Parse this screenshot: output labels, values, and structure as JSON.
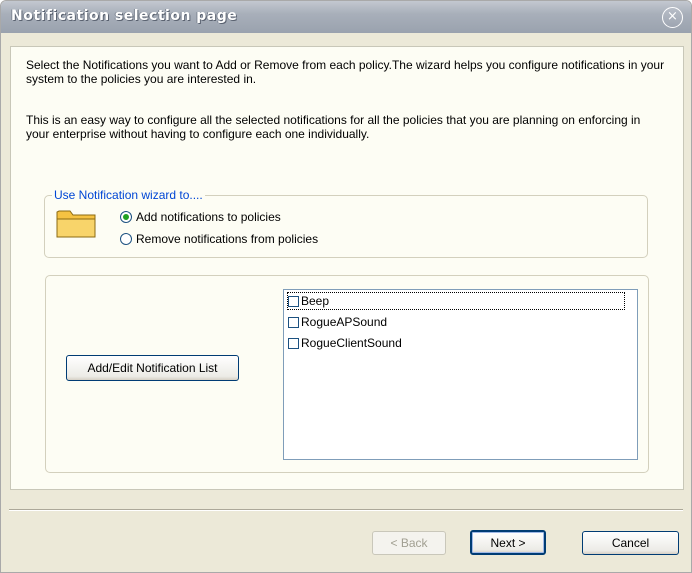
{
  "window": {
    "title": "Notification selection page",
    "close_glyph": "×"
  },
  "intro": {
    "paragraph1": "Select the Notifications you want to Add or Remove from each policy.The wizard helps you configure notifications in your system to the policies you are interested in.",
    "paragraph2": "This is an easy way to configure all the selected  notifications for all the policies that  you are planning on enforcing in your enterprise without having to configure each one individually."
  },
  "wizard_group": {
    "legend": "Use Notification wizard to....",
    "icon": "folder-icon",
    "options": [
      {
        "label": "Add notifications to policies",
        "selected": true
      },
      {
        "label": "Remove notifications from policies",
        "selected": false
      }
    ]
  },
  "notifications": {
    "edit_button_label": "Add/Edit Notification List",
    "items": [
      {
        "label": "Beep",
        "checked": false
      },
      {
        "label": "RogueAPSound",
        "checked": false
      },
      {
        "label": "RogueClientSound",
        "checked": false
      }
    ]
  },
  "footer": {
    "back_label": "< Back",
    "next_label": "Next >",
    "cancel_label": "Cancel"
  },
  "colors": {
    "legend_text": "#0046d5",
    "radio_dot": "#21a121",
    "button_border": "#003c74"
  }
}
